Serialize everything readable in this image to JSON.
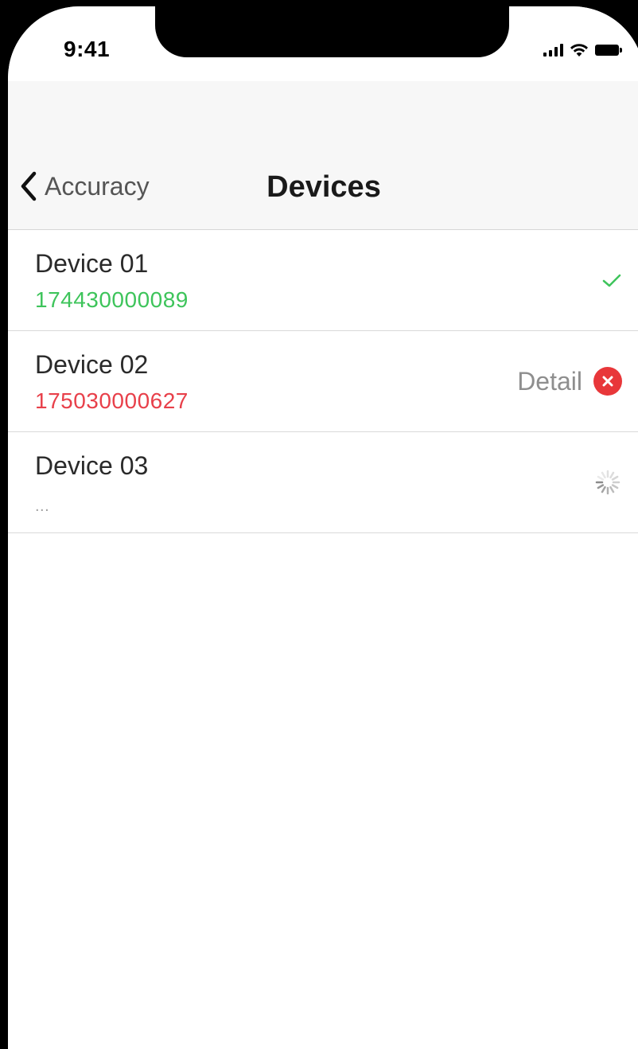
{
  "status_bar": {
    "time": "9:41"
  },
  "navbar": {
    "back_label": "Accuracy",
    "title": "Devices"
  },
  "devices": [
    {
      "name": "Device 01",
      "serial": "174430000089",
      "serial_color": "#3ec45b",
      "status": "success",
      "status_icon": "check-icon"
    },
    {
      "name": "Device 02",
      "serial": "175030000627",
      "serial_color": "#e8404a",
      "status": "error",
      "detail_label": "Detail",
      "status_icon": "error-circle-icon"
    },
    {
      "name": "Device 03",
      "serial": "...",
      "serial_color": "#a0a0a0",
      "status": "loading",
      "status_icon": "spinner-icon"
    }
  ],
  "colors": {
    "success": "#3ec45b",
    "error": "#e8373a",
    "navbar_bg": "#f7f7f7"
  }
}
